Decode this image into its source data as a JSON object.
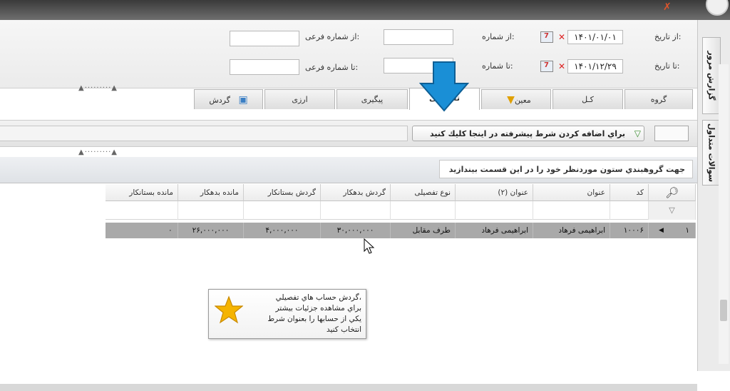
{
  "filters": {
    "from_date_label": "از تاریخ:",
    "from_date_value": "۱۴۰۱/۰۱/۰۱",
    "to_date_label": "تا تاریخ:",
    "to_date_value": "۱۴۰۱/۱۲/۲۹",
    "from_number_label": "از شماره:",
    "from_number_value": "",
    "to_number_label": "تا شماره:",
    "to_number_value": "",
    "from_subnumber_label": "از شماره فرعی:",
    "from_subnumber_value": "",
    "to_subnumber_label": "تا شماره فرعی:",
    "to_subnumber_value": ""
  },
  "tabs": [
    {
      "label": "گروه"
    },
    {
      "label": "کـل"
    },
    {
      "label": "معین"
    },
    {
      "label": "تفصیلی",
      "active": true
    },
    {
      "label": "پیگیری"
    },
    {
      "label": "ارزی"
    },
    {
      "label": "گردش"
    }
  ],
  "condition_button": "براي اضافه كردن شرط پيشرفته در اينجا كليك كنيد",
  "group_by_hint": "جهت گروهبندي ستون موردنظر خود را در اين قسمت بيندازيد",
  "table": {
    "columns": [
      "کد",
      "عنوان",
      "عنوان (۲)",
      "نوع تفصیلی",
      "گردش بدهکار",
      "گردش بستانکار",
      "مانده بدهکار",
      "مانده بستانکار"
    ],
    "rows": [
      {
        "row_no": "۱",
        "code": "۱۰۰۰۶",
        "title": "ابراهیمی فرهاد",
        "title2": "ابراهیمی فرهاد",
        "type": "طرف مقابل",
        "debit_turnover": "۳۰,۰۰۰,۰۰۰",
        "credit_turnover": "۴,۰۰۰,۰۰۰",
        "debit_balance": "۲۶,۰۰۰,۰۰۰",
        "credit_balance": "۰"
      }
    ]
  },
  "tooltip": {
    "lines": [
      "گردش حساب هاي تفصيلي،",
      "براي مشاهده جزئيات بيشتر",
      "يكي از حسابها را بعنوان شرط",
      "انتخاب كنيد"
    ]
  },
  "side_tabs": {
    "report_tab": "گزارش مرور",
    "docs_tab": "سوالات متداول"
  },
  "colors": {
    "arrow": "#1a8fd6",
    "selected_row": "#a9a9a9",
    "star": "#f5b400"
  }
}
